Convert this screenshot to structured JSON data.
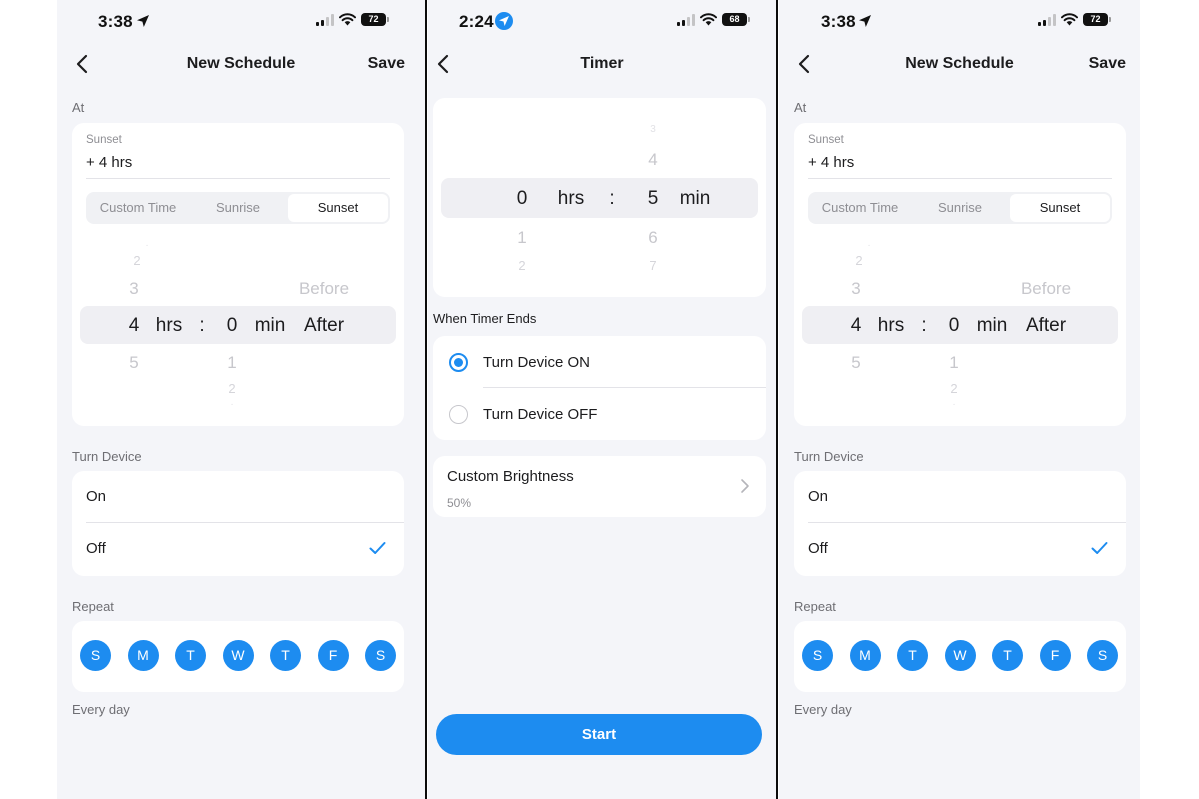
{
  "screens": [
    {
      "status": {
        "time": "3:38",
        "location_icon": "location-arrow-icon",
        "battery": "72"
      },
      "nav": {
        "title": "New Schedule",
        "save": "Save"
      },
      "at_label": "At",
      "at_field": {
        "label": "Sunset",
        "value": "+ 4 hrs"
      },
      "segments": [
        "Custom Time",
        "Sunrise",
        "Sunset"
      ],
      "selected_segment": "Sunset",
      "picker": {
        "hours": {
          "above": [
            "2",
            "3"
          ],
          "selected": "4",
          "below": [
            "5"
          ]
        },
        "hrs_unit": "hrs",
        "colon": ":",
        "minutes": {
          "selected": "0",
          "below": [
            "1",
            "2"
          ]
        },
        "min_unit": "min",
        "direction": {
          "above": "Before",
          "selected": "After"
        }
      },
      "turn_device_label": "Turn Device",
      "turn_device_options": [
        "On",
        "Off"
      ],
      "turn_device_selected": "Off",
      "repeat_label": "Repeat",
      "repeat_days": [
        "S",
        "M",
        "T",
        "W",
        "T",
        "F",
        "S"
      ],
      "repeat_summary": "Every day"
    },
    {
      "status": {
        "time": "2:24",
        "location_icon": "location-arrow-circle-icon",
        "battery": "68"
      },
      "nav": {
        "title": "Timer"
      },
      "picker": {
        "hours": {
          "selected": "0",
          "below": [
            "1",
            "2"
          ]
        },
        "hrs_unit": "hrs",
        "colon": ":",
        "minutes": {
          "above": [
            "3",
            "4"
          ],
          "selected": "5",
          "below": [
            "6",
            "7"
          ]
        },
        "min_unit": "min"
      },
      "when_ends_label": "When Timer Ends",
      "options": [
        "Turn Device ON",
        "Turn Device OFF"
      ],
      "selected_option": "Turn Device ON",
      "brightness": {
        "title": "Custom Brightness",
        "value": "50%"
      },
      "start_button": "Start"
    },
    {
      "status": {
        "time": "3:38",
        "location_icon": "location-arrow-icon",
        "battery": "72"
      },
      "nav": {
        "title": "New Schedule",
        "save": "Save"
      },
      "at_label": "At",
      "at_field": {
        "label": "Sunset",
        "value": "+ 4 hrs"
      },
      "segments": [
        "Custom Time",
        "Sunrise",
        "Sunset"
      ],
      "selected_segment": "Sunset",
      "picker": {
        "hours": {
          "above": [
            "2",
            "3"
          ],
          "selected": "4",
          "below": [
            "5"
          ]
        },
        "hrs_unit": "hrs",
        "colon": ":",
        "minutes": {
          "selected": "0",
          "below": [
            "1",
            "2"
          ]
        },
        "min_unit": "min",
        "direction": {
          "above": "Before",
          "selected": "After"
        }
      },
      "turn_device_label": "Turn Device",
      "turn_device_options": [
        "On",
        "Off"
      ],
      "turn_device_selected": "Off",
      "repeat_label": "Repeat",
      "repeat_days": [
        "S",
        "M",
        "T",
        "W",
        "T",
        "F",
        "S"
      ],
      "repeat_summary": "Every day"
    }
  ],
  "colors": {
    "accent": "#1d8cf0",
    "background": "#f4f5f9",
    "card": "#ffffff",
    "divider": "#0b0b0b"
  }
}
